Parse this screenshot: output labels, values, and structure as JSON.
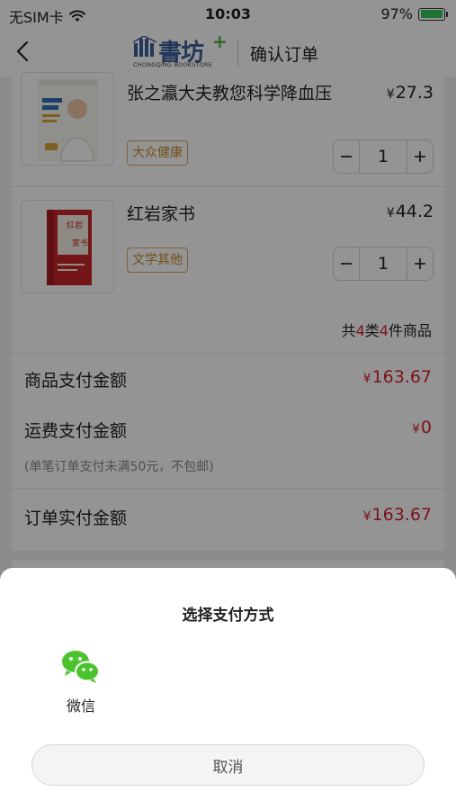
{
  "status_bar": {
    "carrier": "无SIM卡",
    "time": "10:03",
    "battery": "97%",
    "battery_level": 0.97
  },
  "nav": {
    "brand": "書坊",
    "brand_plus": "+",
    "brand_subtitle": "CHONGQING BOOKSTORE",
    "title": "确认订单"
  },
  "items": [
    {
      "name": "张之瀛大夫教您科学降血压",
      "currency": "¥",
      "price": "27.3",
      "tag": "大众健康",
      "quantity": "1",
      "cover_text": "张之瀛大夫"
    },
    {
      "name": "红岩家书",
      "currency": "¥",
      "price": "44.2",
      "tag": "文学其他",
      "quantity": "1",
      "cover_text": "红岩家书"
    }
  ],
  "summary": {
    "prefix": "共",
    "kinds": "4",
    "mid": "类",
    "count": "4",
    "suffix": "件商品"
  },
  "payment": {
    "goods_label": "商品支付金额",
    "goods_currency": "¥",
    "goods_amount": "163.67",
    "shipping_label": "运费支付金额",
    "shipping_currency": "¥",
    "shipping_amount": "0",
    "shipping_note": "(单笔订单支付未满50元，不包邮)",
    "total_label": "订单实付金额",
    "total_currency": "¥",
    "total_amount": "163.67"
  },
  "sheet": {
    "title": "选择支付方式",
    "options": [
      {
        "label": "微信",
        "icon": "wechat-icon"
      }
    ],
    "cancel": "取消"
  },
  "colors": {
    "accent_red": "#d6212f",
    "tag_orange": "#c98a2b",
    "wechat_green": "#4bc32e",
    "brand_blue": "#3d5f99"
  }
}
